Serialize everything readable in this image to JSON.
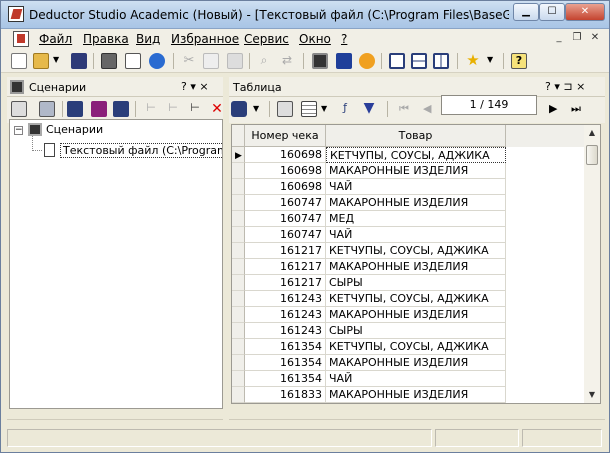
{
  "window": {
    "title": "Deductor Studio Academic (Новый) - [Текстовый файл (C:\\Program Files\\BaseGroup\\D..."
  },
  "menu": [
    "Файл",
    "Правка",
    "Вид",
    "Избранное",
    "Сервис",
    "Окно",
    "?"
  ],
  "left_panel": {
    "title": "Сценарии",
    "controls": "? ▾ ×",
    "tree": [
      {
        "label": "Сценарии",
        "level": 0,
        "expanded": true
      },
      {
        "label": "Текстовый файл (C:\\Program Files",
        "level": 1
      }
    ]
  },
  "right_panel": {
    "title": "Таблица",
    "controls": "? ▾ ⊐ ×",
    "navigator": {
      "value": "1 / 149"
    }
  },
  "table": {
    "columns": [
      "Номер чека",
      "Товар"
    ],
    "rows": [
      [
        "160698",
        "КЕТЧУПЫ, СОУСЫ, АДЖИКА"
      ],
      [
        "160698",
        "МАКАРОННЫЕ ИЗДЕЛИЯ"
      ],
      [
        "160698",
        "ЧАЙ"
      ],
      [
        "160747",
        "МАКАРОННЫЕ ИЗДЕЛИЯ"
      ],
      [
        "160747",
        "МЕД"
      ],
      [
        "160747",
        "ЧАЙ"
      ],
      [
        "161217",
        "КЕТЧУПЫ, СОУСЫ, АДЖИКА"
      ],
      [
        "161217",
        "МАКАРОННЫЕ ИЗДЕЛИЯ"
      ],
      [
        "161217",
        "СЫРЫ"
      ],
      [
        "161243",
        "КЕТЧУПЫ, СОУСЫ, АДЖИКА"
      ],
      [
        "161243",
        "МАКАРОННЫЕ ИЗДЕЛИЯ"
      ],
      [
        "161243",
        "СЫРЫ"
      ],
      [
        "161354",
        "КЕТЧУПЫ, СОУСЫ, АДЖИКА"
      ],
      [
        "161354",
        "МАКАРОННЫЕ ИЗДЕЛИЯ"
      ],
      [
        "161354",
        "ЧАЙ"
      ],
      [
        "161833",
        "МАКАРОННЫЕ ИЗДЕЛИЯ"
      ]
    ],
    "current_row_marker": "▶"
  },
  "icons": {
    "title_buttons": [
      "minimize-icon",
      "maximize-icon",
      "close-icon"
    ],
    "toolbar": [
      "new-icon",
      "open-icon",
      "save-icon",
      "print-icon",
      "preview-icon",
      "web-icon",
      "cut-icon",
      "copy-icon",
      "paste-icon",
      "find-icon",
      "replace-icon",
      "scenario-icon",
      "data-icon",
      "report-icon",
      "tile-icon",
      "split-h-icon",
      "split-v-icon",
      "favorite-icon",
      "help-icon"
    ]
  },
  "colors": {
    "titlebar": "#b7cfe9",
    "close_button": "#c4432f",
    "accent_blue": "#2a5aa8"
  }
}
